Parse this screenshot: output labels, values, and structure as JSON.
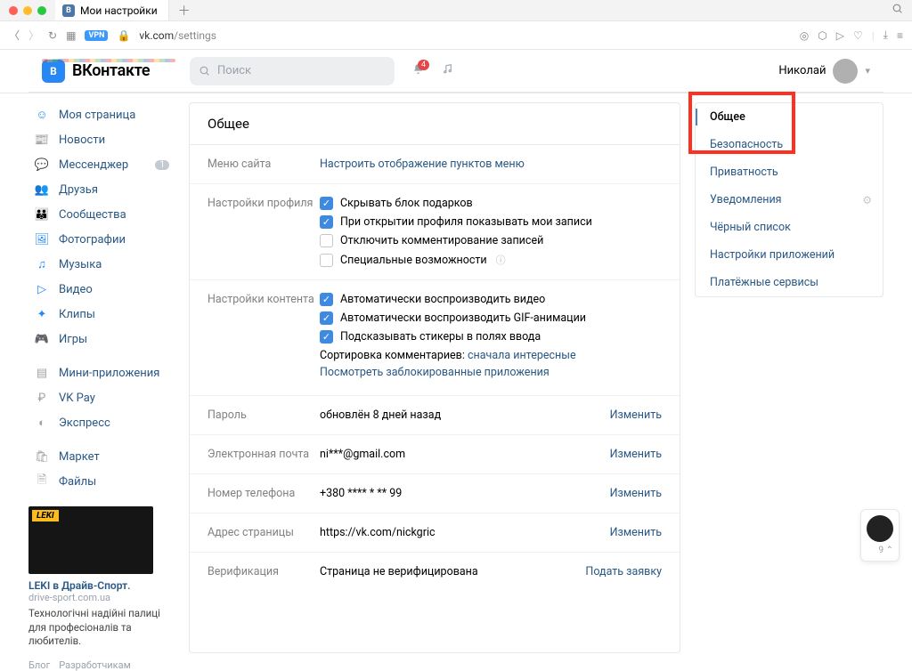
{
  "browser": {
    "tab_title": "Мои настройки",
    "url_prefix": "vk.com",
    "url_path": "/settings",
    "vpn_label": "VPN"
  },
  "header": {
    "brand": "ВКонтакте",
    "search_placeholder": "Поиск",
    "notif_count": "4",
    "user_name": "Николай"
  },
  "sidebar": {
    "items": [
      {
        "label": "Моя страница",
        "icon": "user"
      },
      {
        "label": "Новости",
        "icon": "news"
      },
      {
        "label": "Мессенджер",
        "icon": "chat",
        "badge": "1"
      },
      {
        "label": "Друзья",
        "icon": "friends"
      },
      {
        "label": "Сообщества",
        "icon": "groups"
      },
      {
        "label": "Фотографии",
        "icon": "photo"
      },
      {
        "label": "Музыка",
        "icon": "music"
      },
      {
        "label": "Видео",
        "icon": "video"
      },
      {
        "label": "Клипы",
        "icon": "clips"
      },
      {
        "label": "Игры",
        "icon": "games"
      }
    ],
    "items2": [
      {
        "label": "Мини-приложения",
        "icon": "apps"
      },
      {
        "label": "VK Pay",
        "icon": "pay"
      },
      {
        "label": "Экспресс",
        "icon": "express"
      }
    ],
    "items3": [
      {
        "label": "Маркет",
        "icon": "market"
      },
      {
        "label": "Файлы",
        "icon": "files"
      }
    ]
  },
  "ad": {
    "badge": "LEKI",
    "title": "LEKI в Драйв-Спорт.",
    "domain": "drive-sport.com.ua",
    "text": "Технологічні надійні палиці для професіоналів та любителів."
  },
  "footer": {
    "blog": "Блог",
    "dev": "Разработчикам"
  },
  "settings": {
    "title": "Общее",
    "rows": {
      "menu": {
        "label": "Меню сайта",
        "link": "Настроить отображение пунктов меню"
      },
      "profile": {
        "label": "Настройки профиля",
        "c1": "Скрывать блок подарков",
        "c2": "При открытии профиля показывать мои записи",
        "c3": "Отключить комментирование записей",
        "c4": "Специальные возможности"
      },
      "content": {
        "label": "Настройки контента",
        "c1": "Автоматически воспроизводить видео",
        "c2": "Автоматически воспроизводить GIF-анимации",
        "c3": "Подсказывать стикеры в полях ввода",
        "sort_label": "Сортировка комментариев:",
        "sort_value": "сначала интересные",
        "blocked_link": "Посмотреть заблокированные приложения"
      },
      "password": {
        "label": "Пароль",
        "value": "обновлён 8 дней назад",
        "action": "Изменить"
      },
      "email": {
        "label": "Электронная почта",
        "value": "ni***@gmail.com",
        "action": "Изменить"
      },
      "phone": {
        "label": "Номер телефона",
        "value": "+380 **** * ** 99",
        "action": "Изменить"
      },
      "address": {
        "label": "Адрес страницы",
        "value": "https://vk.com/nickgric",
        "action": "Изменить"
      },
      "verification": {
        "label": "Верификация",
        "value": "Страница не верифицирована",
        "action": "Подать заявку"
      }
    }
  },
  "rightnav": {
    "general": "Общее",
    "security": "Безопасность",
    "privacy": "Приватность",
    "notifications": "Уведомления",
    "blacklist": "Чёрный список",
    "apps": "Настройки приложений",
    "payments": "Платёжные сервисы"
  },
  "bubble": {
    "count": "9"
  }
}
